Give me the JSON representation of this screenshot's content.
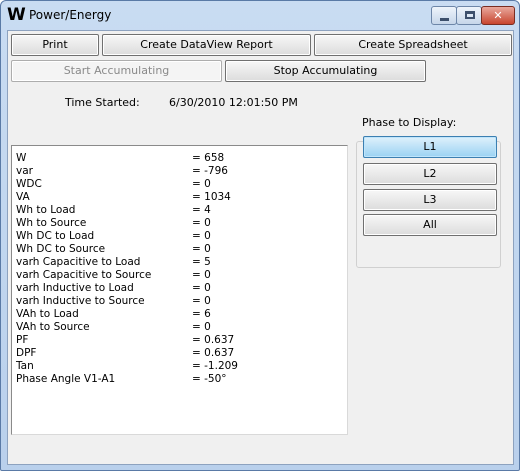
{
  "window": {
    "icon": "W",
    "title": "Power/Energy",
    "minimize_icon": "minimize-icon",
    "maximize_icon": "maximize-icon",
    "close_icon": "close-icon",
    "close_glyph": "✕"
  },
  "toolbar": {
    "print_label": "Print",
    "dataview_label": "Create DataView Report",
    "spreadsheet_label": "Create Spreadsheet",
    "start_label": "Start Accumulating",
    "stop_label": "Stop Accumulating"
  },
  "time": {
    "label": "Time Started:",
    "value": "6/30/2010 12:01:50 PM"
  },
  "phase": {
    "label": "Phase to Display:",
    "options": [
      "L1",
      "L2",
      "L3",
      "All"
    ],
    "selected": "L1"
  },
  "readings": [
    {
      "name": "W",
      "value": "= 658"
    },
    {
      "name": "var",
      "value": "= -796"
    },
    {
      "name": "WDC",
      "value": "= 0"
    },
    {
      "name": "VA",
      "value": "= 1034"
    },
    {
      "name": "Wh to Load",
      "value": "= 4"
    },
    {
      "name": "Wh to Source",
      "value": "= 0"
    },
    {
      "name": "Wh DC to Load",
      "value": "= 0"
    },
    {
      "name": "Wh DC to Source",
      "value": "= 0"
    },
    {
      "name": "varh Capacitive to Load",
      "value": "= 5"
    },
    {
      "name": "varh Capacitive to Source",
      "value": "= 0"
    },
    {
      "name": "varh Inductive to Load",
      "value": "= 0"
    },
    {
      "name": "varh Inductive to Source",
      "value": "= 0"
    },
    {
      "name": "VAh to Load",
      "value": "= 6"
    },
    {
      "name": "VAh to Source",
      "value": "= 0"
    },
    {
      "name": "PF",
      "value": "= 0.637"
    },
    {
      "name": "DPF",
      "value": "= 0.637"
    },
    {
      "name": "Tan",
      "value": "= -1.209"
    },
    {
      "name": "Phase Angle V1-A1",
      "value": "= -50°"
    }
  ]
}
